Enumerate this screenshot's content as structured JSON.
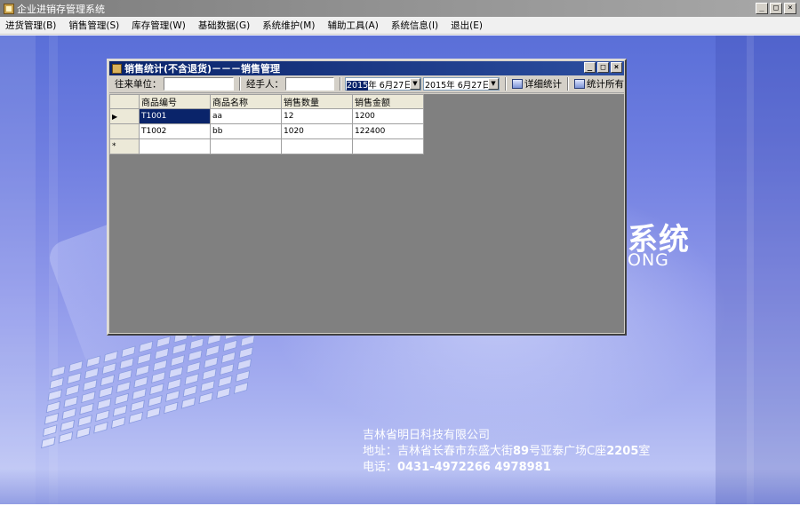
{
  "window": {
    "title": "企业进销存管理系统",
    "controls": [
      "_",
      "□",
      "×"
    ]
  },
  "menu": [
    "进货管理(B)",
    "销售管理(S)",
    "库存管理(W)",
    "基础数据(G)",
    "系统维护(M)",
    "辅助工具(A)",
    "系统信息(I)",
    "退出(E)"
  ],
  "background": {
    "brand_text_1": "系统",
    "brand_text_2": "ONG",
    "company": {
      "name": "吉林省明日科技有限公司",
      "address_prefix": "地址：吉林省长春市东盛大街",
      "address_number": "89",
      "address_mid": "号亚泰广场C座",
      "address_room": "2205",
      "address_suffix": "室",
      "phone_prefix": "电话：",
      "phone": "0431-4972266  4978981"
    }
  },
  "child_window": {
    "title": "销售统计(不含退货)－－－销售管理",
    "toolbar": {
      "partner_label": "往来单位：",
      "handler_label": "经手人：",
      "date_from": {
        "year": "2015",
        "rest": "年  6月27日"
      },
      "date_to": "2015年  6月27日",
      "detail_button": "详细统计",
      "all_button": "统计所有"
    },
    "grid": {
      "columns": [
        "商品编号",
        "商品名称",
        "销售数量",
        "销售金额"
      ],
      "rows": [
        [
          "T1001",
          "aa",
          "12",
          "1200"
        ],
        [
          "T1002",
          "bb",
          "1020",
          "122400"
        ]
      ],
      "current_row_marker": "▶",
      "new_row_marker": "*"
    }
  },
  "colors": {
    "child_title_bar": "#0a246a",
    "desktop": "#6f7ee0",
    "selection": "#0a246a"
  }
}
